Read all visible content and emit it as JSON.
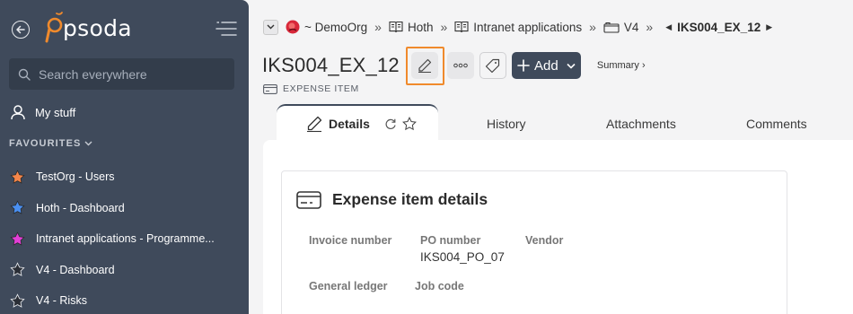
{
  "sidebar": {
    "logo_text": "psoda",
    "search_placeholder": "Search everywhere",
    "my_stuff": "My stuff",
    "favourites_heading": "FAVOURITES",
    "favourites": [
      {
        "label": "TestOrg - Users",
        "color": "#f4864a"
      },
      {
        "label": "Hoth - Dashboard",
        "color": "#4a8ff0"
      },
      {
        "label": "Intranet applications - Programme...",
        "color": "#e23fd6"
      },
      {
        "label": "V4 - Dashboard",
        "color": "#2a2e36"
      },
      {
        "label": "V4 - Risks",
        "color": "#2a2e36"
      }
    ]
  },
  "breadcrumb": {
    "org": "~ DemoOrg",
    "items": [
      "Hoth",
      "Intranet applications",
      "V4"
    ],
    "current": "IKS004_EX_12",
    "separator": "»"
  },
  "header": {
    "title": "IKS004_EX_12",
    "add_label": "Add",
    "summary_link": "Summary ›",
    "subtitle": "EXPENSE ITEM"
  },
  "tabs": {
    "details": "Details",
    "history": "History",
    "attachments": "Attachments",
    "comments": "Comments"
  },
  "card": {
    "title": "Expense item details",
    "fields": {
      "invoice_number_label": "Invoice number",
      "po_number_label": "PO number",
      "po_number_value": "IKS004_PO_07",
      "vendor_label": "Vendor",
      "general_ledger_label": "General ledger",
      "job_code_label": "Job code"
    }
  },
  "colors": {
    "sidebar_bg": "#3f4a5b",
    "highlight": "#f08a2c",
    "logo_accent": "#f08a2c"
  }
}
